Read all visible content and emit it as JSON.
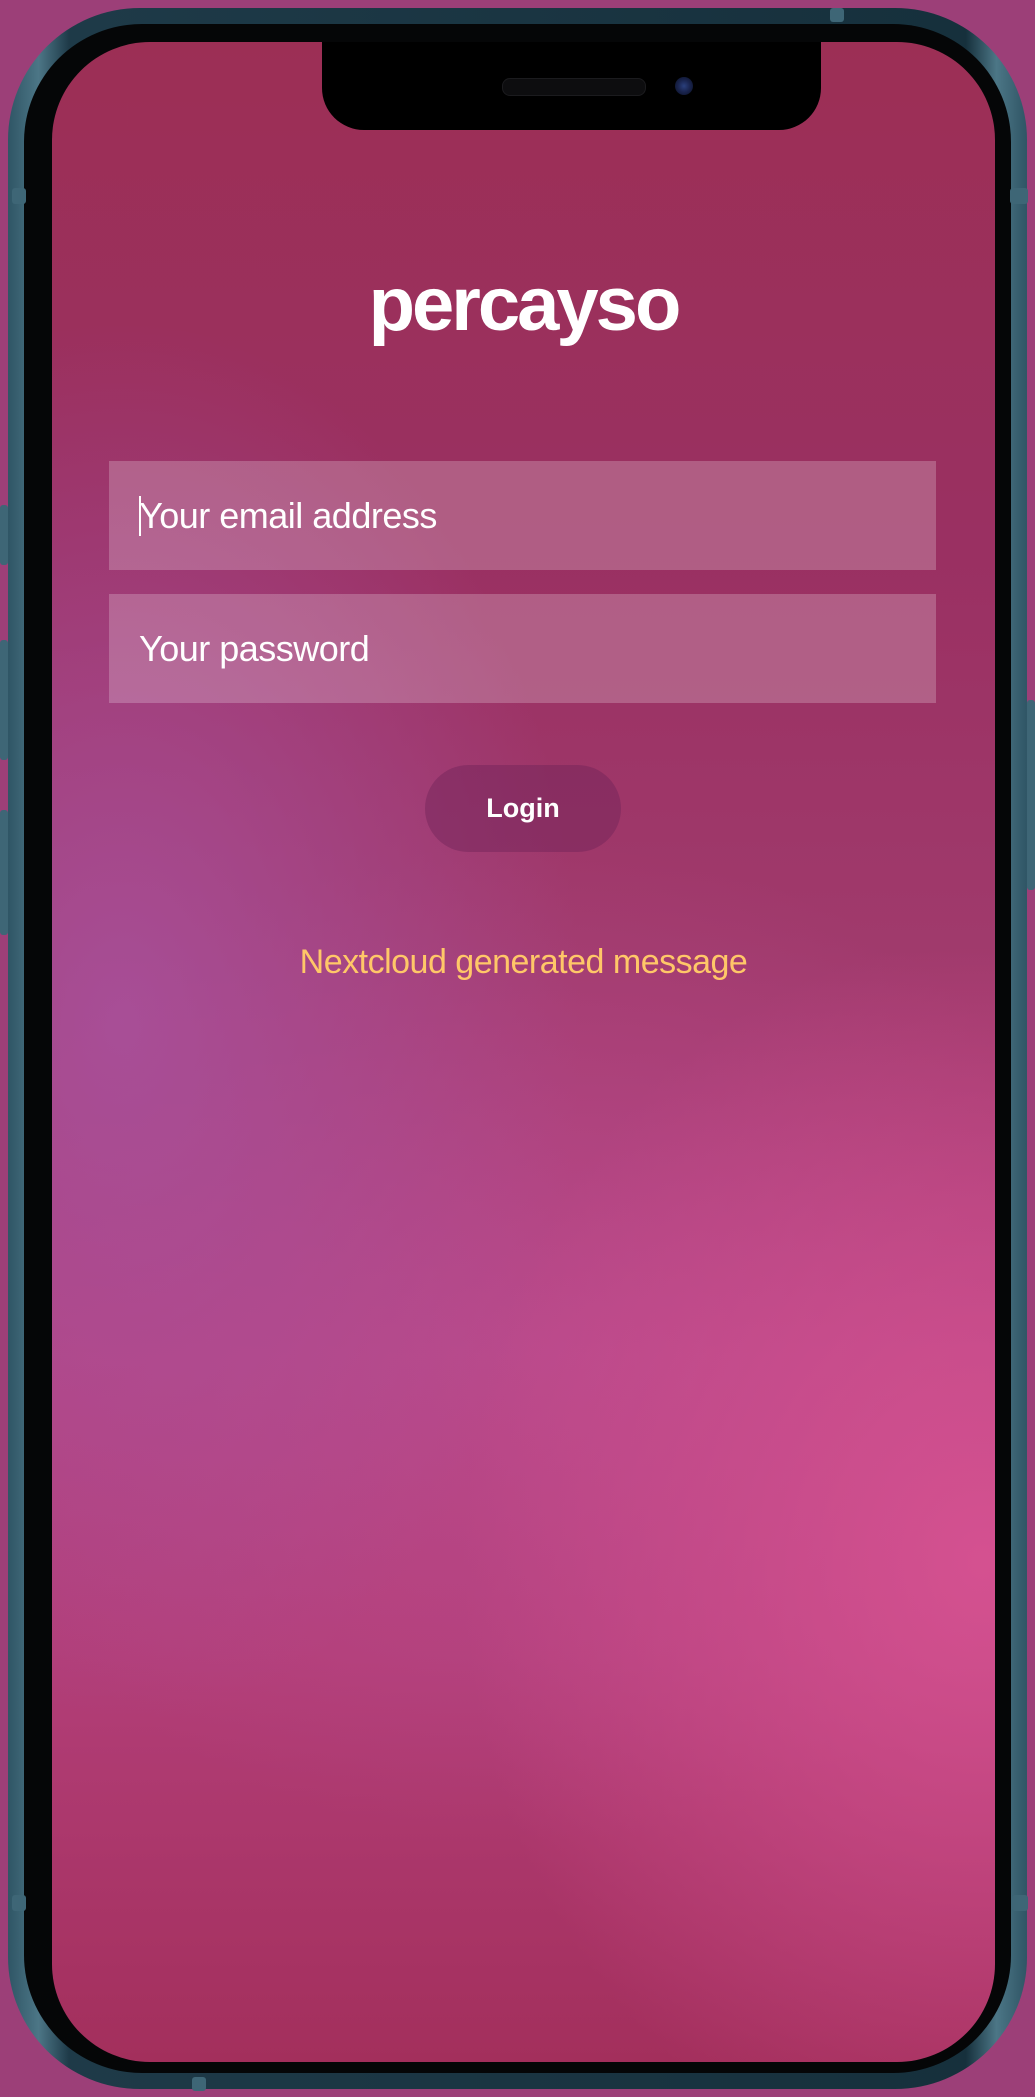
{
  "app": {
    "logo_text": "percayso"
  },
  "form": {
    "email_placeholder": "Your email address",
    "password_placeholder": "Your password",
    "login_label": "Login"
  },
  "message": {
    "text": "Nextcloud generated message"
  },
  "colors": {
    "background": "#9c3f78",
    "message": "#ffc768",
    "field_fill": "rgba(255,255,255,0.22)",
    "frame": "#2f5565"
  }
}
